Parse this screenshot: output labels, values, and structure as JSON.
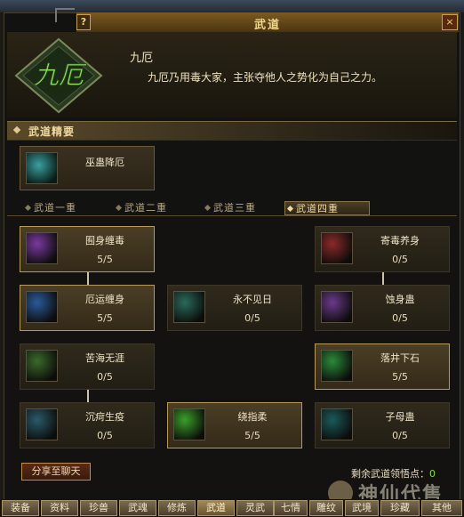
{
  "window": {
    "title": "武道",
    "help_label": "?",
    "close_label": "×"
  },
  "school": {
    "emblem_text": "九厄",
    "name": "九厄",
    "description": "九厄乃用毒大家，主张夺他人之势化为自己之力。"
  },
  "essence_section": {
    "label": "武道精要",
    "skill": {
      "name": "巫蛊降厄",
      "icon": "wugu-jiange-icon",
      "color": "#3aa0a0"
    }
  },
  "tabs": [
    {
      "label": "武道一重"
    },
    {
      "label": "武道二重"
    },
    {
      "label": "武道三重"
    },
    {
      "label": "武道四重",
      "active": true
    }
  ],
  "skills": [
    {
      "name": "囿身缠毒",
      "value": "5/5",
      "icon": "purple-swirl-icon",
      "color": "#7a3aa0",
      "highlight": true
    },
    {
      "name": "寄毒养身",
      "value": "0/5",
      "icon": "red-poison-icon",
      "color": "#8a2a2a"
    },
    {
      "name": "厄运缠身",
      "value": "5/5",
      "icon": "blue-arm-icon",
      "color": "#2a5a9a",
      "highlight": true
    },
    {
      "name": "永不见日",
      "value": "0/5",
      "icon": "dark-shadow-icon",
      "color": "#2a6a5a"
    },
    {
      "name": "蚀身蛊",
      "value": "0/5",
      "icon": "purple-arm-icon",
      "color": "#6a3a8a"
    },
    {
      "name": "苦海无涯",
      "value": "0/5",
      "icon": "green-vine-icon",
      "color": "#3a6a2a"
    },
    {
      "name": "落井下石",
      "value": "5/5",
      "icon": "red-sprout-icon",
      "color": "#2a8a3a",
      "highlight": true
    },
    {
      "name": "沉疴生疫",
      "value": "0/5",
      "icon": "green-vine-icon",
      "color": "#2a5a6a"
    },
    {
      "name": "绕指柔",
      "value": "5/5",
      "icon": "green-slash-icon",
      "color": "#3aa02a",
      "highlight": true
    },
    {
      "name": "子母蛊",
      "value": "0/5",
      "icon": "teal-swirl-icon",
      "color": "#1a5a5a"
    }
  ],
  "footer": {
    "share_label": "分享至聊天",
    "remaining_label": "剩余武道领悟点：",
    "remaining_value": "0",
    "watermark": "神仙代售"
  },
  "bottom_menu": [
    {
      "label": "装备"
    },
    {
      "label": "资料"
    },
    {
      "label": "珍兽"
    },
    {
      "label": "武魂"
    },
    {
      "label": "修炼"
    },
    {
      "label": "武道",
      "active": true
    },
    {
      "label": "灵武"
    },
    {
      "label": "七情"
    },
    {
      "label": "雕纹"
    },
    {
      "label": "武境"
    },
    {
      "label": "珍藏"
    },
    {
      "label": "其他"
    }
  ]
}
